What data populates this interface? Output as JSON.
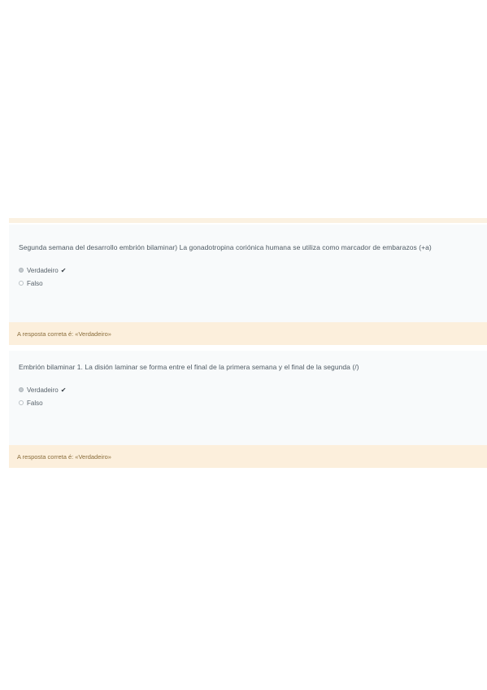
{
  "questions": [
    {
      "text": "Segunda semana del desarrollo embrión bilaminar) La gonadotropina coriónica humana se utiliza como marcador de embarazos (+a)",
      "options": [
        {
          "label": "Verdadeiro",
          "selected": true,
          "correct_mark": "✔"
        },
        {
          "label": "Falso",
          "selected": false
        }
      ],
      "feedback": "A resposta correta é: «Verdadeiro»"
    },
    {
      "text": "Embrión bilaminar 1. La disión laminar se forma entre el final de la primera semana y el final de la segunda (/)",
      "options": [
        {
          "label": "Verdadeiro",
          "selected": true,
          "correct_mark": "✔"
        },
        {
          "label": "Falso",
          "selected": false
        }
      ],
      "feedback": "A resposta correta é: «Verdadeiro»"
    }
  ],
  "icons": {
    "correct": "check-icon",
    "radio": "radio-icon"
  },
  "colors": {
    "question_bg": "#f8fafb",
    "feedback_bg": "#fcefdc",
    "feedback_text": "#8a6d3b"
  }
}
